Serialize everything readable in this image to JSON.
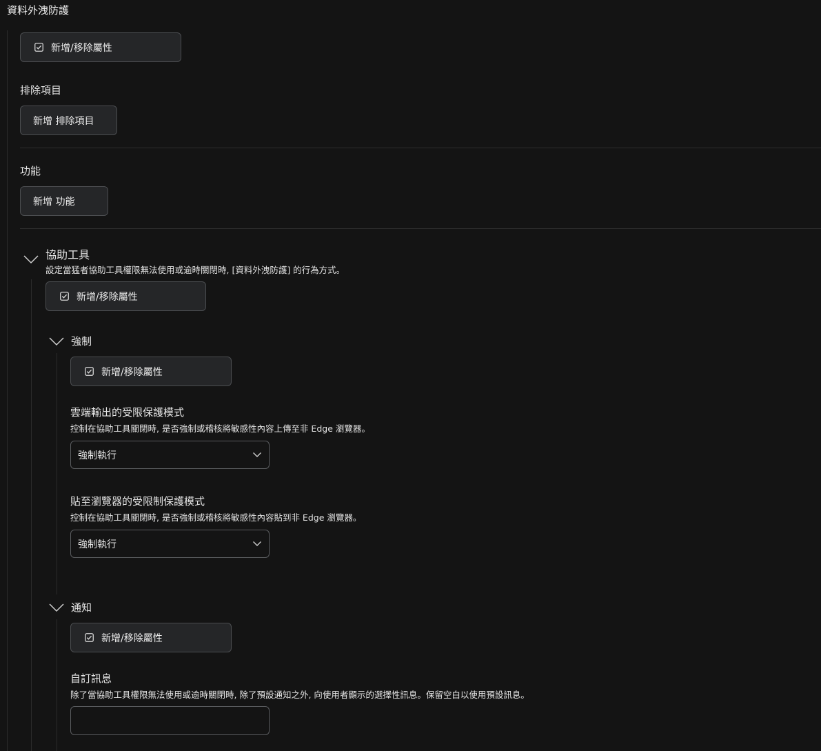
{
  "page": {
    "title": "資料外洩防護",
    "add_remove_attr_label": "新增/移除屬性"
  },
  "exclusions": {
    "title": "排除項目",
    "add_button": "新增 排除項目"
  },
  "features": {
    "title": "功能",
    "add_button": "新增 功能"
  },
  "assist_tools": {
    "title": "協助工具",
    "description": "設定當猛者協助工具權限無法使用或逾時關閉時, [資料外洩防護] 的行為方式。",
    "enforce": {
      "title": "強制",
      "cloud_mode": {
        "title": "雲端輸出的受限保護模式",
        "description": "控制在協助工具關閉時, 是否強制或稽核將敏感性內容上傳至非 Edge 瀏覽器。",
        "value": "強制執行"
      },
      "paste_mode": {
        "title": "貼至瀏覽器的受限制保護模式",
        "description": "控制在協助工具關閉時, 是否強制或稽核將敏感性內容貼到非 Edge 瀏覽器。",
        "value": "強制執行"
      }
    },
    "notification": {
      "title": "通知",
      "custom_message": {
        "title": "自訂訊息",
        "description": "除了當協助工具權限無法使用或逾時關閉時, 除了預設通知之外, 向使用者顯示的選擇性訊息。保留空白以使用預設訊息。",
        "value": ""
      }
    }
  }
}
